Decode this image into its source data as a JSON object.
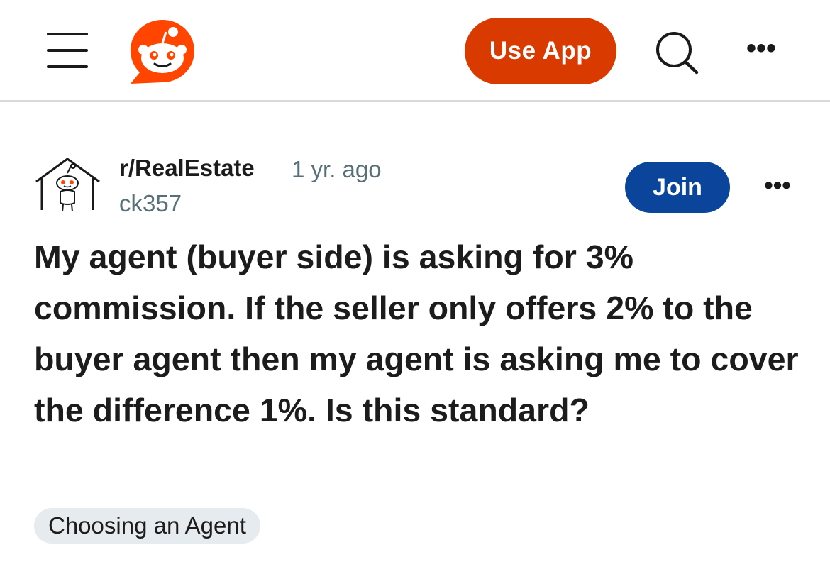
{
  "header": {
    "use_app_label": "Use App",
    "more_label": "•••",
    "brand_color": "#d93a00",
    "icons": [
      "hamburger-menu-icon",
      "reddit-logo-icon",
      "search-icon",
      "more-options-icon"
    ]
  },
  "post": {
    "subreddit": "r/RealEstate",
    "time_ago": "1 yr. ago",
    "author": "ck357",
    "join_label": "Join",
    "join_color": "#0a449b",
    "more_label": "•••",
    "title": "My agent (buyer side) is asking for 3% commission. If the seller only offers 2% to the buyer agent then my agent is asking me to cover the difference 1%. Is this standard?",
    "flair": "Choosing an Agent",
    "community_icon": "house-snoo-icon"
  }
}
